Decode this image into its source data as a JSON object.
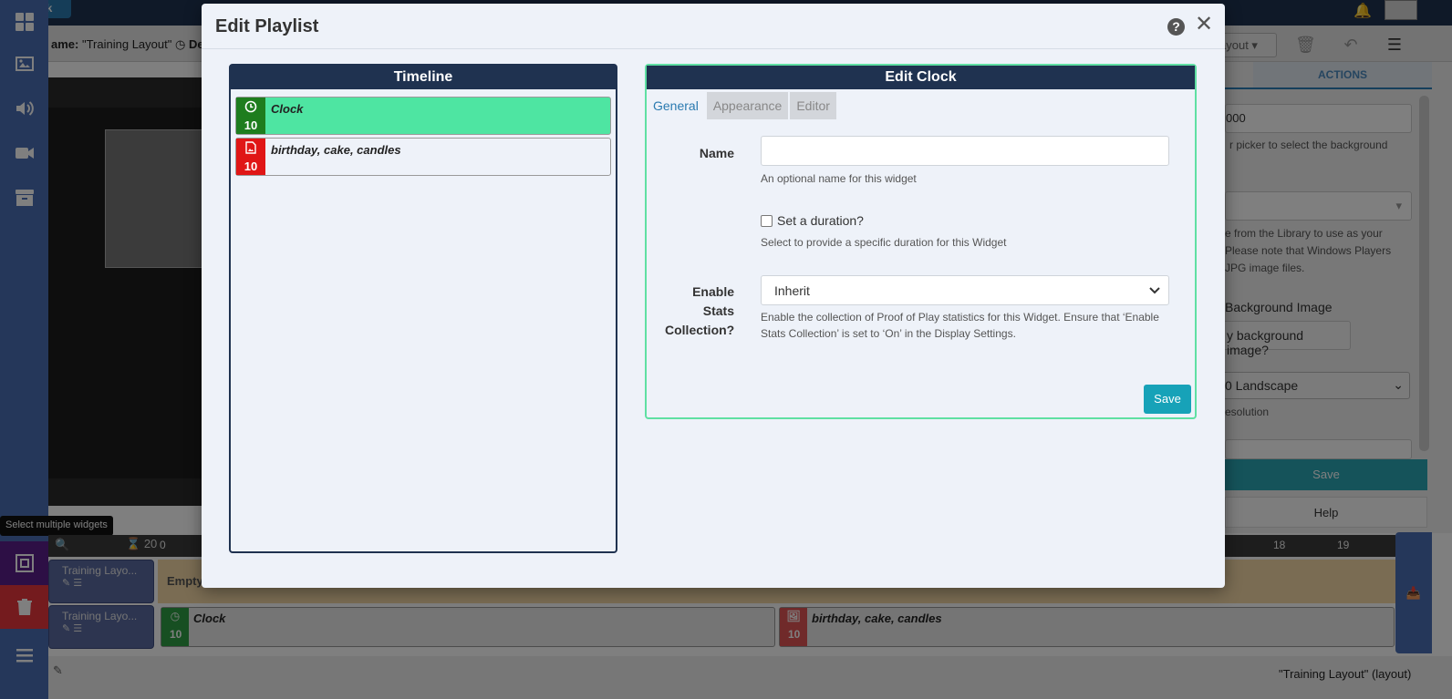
{
  "background": {
    "back_label": "ck",
    "layout_name_prefix": "ame:",
    "layout_name": "\"Training Layout\"",
    "duration_prefix": "De",
    "toolbar_select": "ayout",
    "right_panel": {
      "color_value": "000",
      "color_help": "r picker to select the background",
      "library_help_lines": [
        "e from the Library to use as your",
        "Please note that Windows Players",
        "JPG image files."
      ],
      "bg_image_label": "Background Image",
      "bg_image_button": "y background image?",
      "resolution_value": "0 Landscape",
      "resolution_help": "esolution",
      "actions_tab": "ACTIONS",
      "save_button": "Save",
      "help_button": "Help"
    },
    "tooltip": "Select multiple widgets",
    "timeline": {
      "zoom_value": "20",
      "ticks": [
        "0",
        "18",
        "19"
      ],
      "rows": [
        {
          "label": "Training Layo..."
        },
        {
          "label": "Training Layo..."
        }
      ],
      "empty_label": "Empty",
      "widgets": [
        {
          "name": "Clock",
          "duration": "10",
          "color": "#2f9e44"
        },
        {
          "name": "birthday, cake, candles",
          "duration": "10",
          "color": "#e05454"
        }
      ]
    },
    "status_text": "\"Training Layout\" (layout)"
  },
  "modal": {
    "title": "Edit Playlist",
    "help_icon": "question-circle-icon",
    "close_icon": "close-icon",
    "timeline_panel": {
      "title": "Timeline",
      "items": [
        {
          "name": "Clock",
          "duration": "10",
          "icon": "clock-icon",
          "color": "#1e7d1e",
          "bg": "#4ee5a2"
        },
        {
          "name": "birthday, cake, candles",
          "duration": "10",
          "icon": "image-file-icon",
          "color": "#e01616",
          "bg": "#eef2f9"
        }
      ]
    },
    "edit_panel": {
      "title": "Edit Clock",
      "tabs": [
        "General",
        "Appearance",
        "Editor"
      ],
      "name_label": "Name",
      "name_value": "",
      "name_help": "An optional name for this widget",
      "duration_check_label": "Set a duration?",
      "duration_help": "Select to provide a specific duration for this Widget",
      "stats_label_lines": [
        "Enable",
        "Stats",
        "Collection?"
      ],
      "stats_value": "Inherit",
      "stats_help_lines": [
        "Enable the collection of Proof of Play statistics for this Widget. Ensure that ‘Enable",
        "Stats Collection’ is set to ‘On’ in the Display Settings."
      ],
      "save_label": "Save"
    }
  },
  "colors": {
    "navy": "#1f3250",
    "accent_green": "#4ee5a2",
    "save_teal": "#17a2b8",
    "sidebar_blue": "#4a6eb5"
  }
}
